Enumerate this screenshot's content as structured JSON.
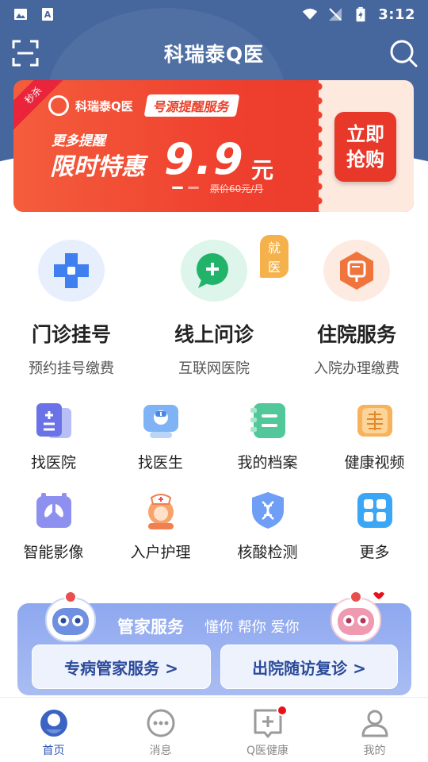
{
  "status_bar": {
    "time": "3:12"
  },
  "header": {
    "title": "科瑞泰Q医"
  },
  "banner": {
    "ribbon": "秒杀",
    "brand": "科瑞泰Q医",
    "tag": "号源提醒服务",
    "line1": "更多提醒",
    "line2": "限时特惠",
    "price": "9.9",
    "unit": "元",
    "original_price": "原价60元/月",
    "buy_label": "立即抢购",
    "buy_line1": "立即",
    "buy_line2": "抢购"
  },
  "main_services": [
    {
      "title": "门诊挂号",
      "sub": "预约挂号缴费",
      "color": "#3f7ff0"
    },
    {
      "title": "线上问诊",
      "sub": "互联网医院",
      "badge": "就医",
      "color": "#22b36a"
    },
    {
      "title": "住院服务",
      "sub": "入院办理缴费",
      "color": "#f0743d"
    }
  ],
  "grid": [
    {
      "label": "找医院",
      "icon": "hospital-icon"
    },
    {
      "label": "找医生",
      "icon": "doctor-icon"
    },
    {
      "label": "我的档案",
      "icon": "records-icon"
    },
    {
      "label": "健康视频",
      "icon": "video-icon"
    },
    {
      "label": "智能影像",
      "icon": "imaging-icon"
    },
    {
      "label": "入户护理",
      "icon": "nurse-icon"
    },
    {
      "label": "核酸检测",
      "icon": "dna-icon"
    },
    {
      "label": "更多",
      "icon": "more-icon"
    }
  ],
  "butler": {
    "title": "管家服务",
    "slogan": "懂你 帮你 爱你",
    "button1": "专病管家服务 >",
    "button2": "出院随访复诊 >"
  },
  "bottom_nav": [
    {
      "label": "首页",
      "active": true
    },
    {
      "label": "消息",
      "active": false
    },
    {
      "label": "Q医健康",
      "active": false
    },
    {
      "label": "我的",
      "active": false
    }
  ],
  "colors": {
    "primary": "#46669e",
    "accent": "#2f57b5",
    "promo": "#ef3f2e"
  }
}
